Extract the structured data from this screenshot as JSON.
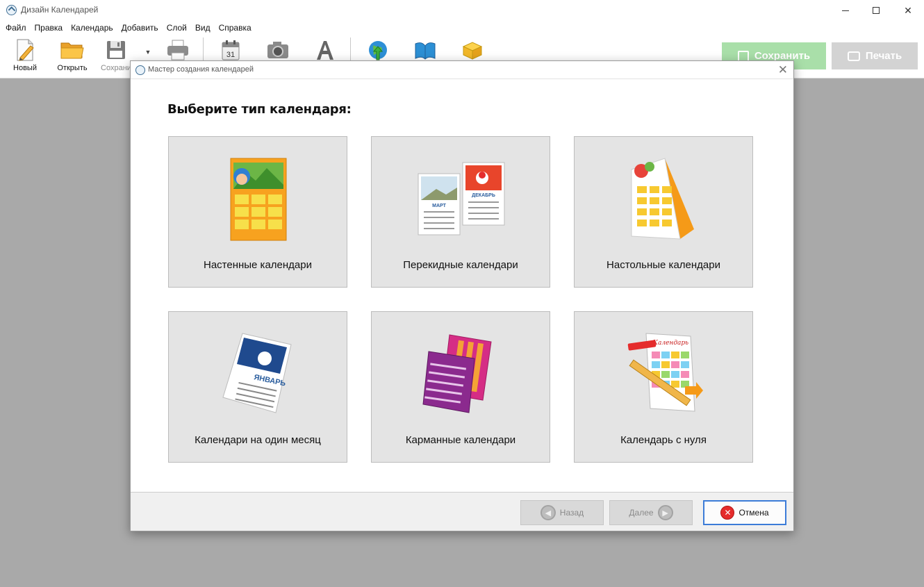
{
  "window": {
    "title": "Дизайн Календарей"
  },
  "menu": [
    "Файл",
    "Правка",
    "Календарь",
    "Добавить",
    "Слой",
    "Вид",
    "Справка"
  ],
  "toolbar": {
    "new_label": "Новый",
    "open_label": "Открыть",
    "save_label": "Сохрани",
    "save_main_label": "Сохранить",
    "print_main_label": "Печать",
    "calendar_day": "31"
  },
  "dialog": {
    "title": "Мастер создания календарей",
    "heading": "Выберите тип календаря:",
    "tiles": [
      {
        "label": "Настенные календари",
        "icon": "wall-calendar-icon"
      },
      {
        "label": "Перекидные календари",
        "icon": "flip-calendar-icon",
        "month_left": "МАРТ",
        "month_right": "ДЕКАБРЬ"
      },
      {
        "label": "Настольные календари",
        "icon": "desk-calendar-icon"
      },
      {
        "label": "Календари на один месяц",
        "icon": "month-calendar-icon",
        "month": "ЯНВАРЬ"
      },
      {
        "label": "Карманные календари",
        "icon": "pocket-calendar-icon"
      },
      {
        "label": "Календарь с нуля",
        "icon": "blank-calendar-icon",
        "banner": "Календарь"
      }
    ],
    "back_label": "Назад",
    "next_label": "Далее",
    "cancel_label": "Отмена"
  },
  "colors": {
    "accent_blue": "#3c7cd8",
    "save_green": "#a9dfa9",
    "cancel_red": "#e52c2c",
    "workspace": "#a9a9a9"
  }
}
